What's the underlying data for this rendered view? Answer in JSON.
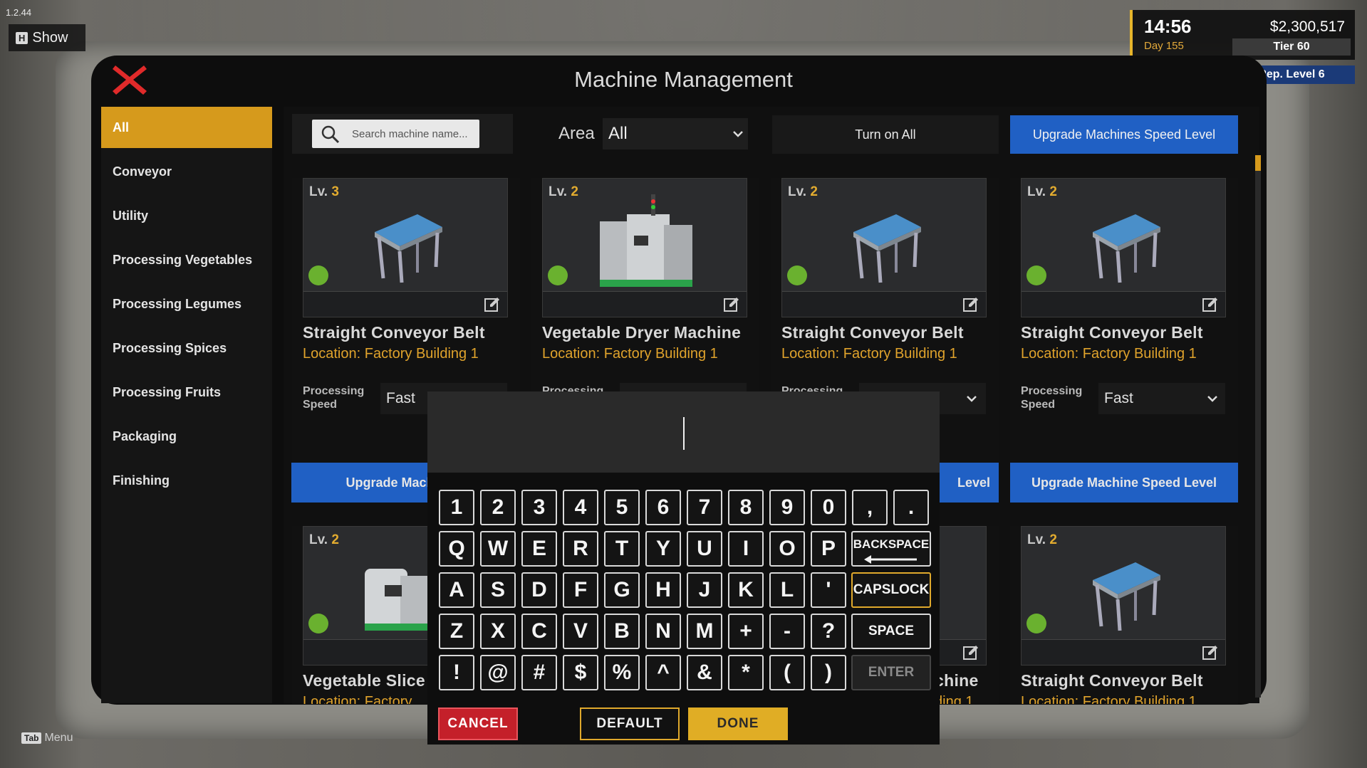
{
  "version": "1.2.44",
  "show_toggle": {
    "key": "H",
    "label": "Show"
  },
  "hud": {
    "time": "14:56",
    "day": "Day 155",
    "money": "$2,300,517",
    "tier": "Tier 60",
    "rep": "Rep. Level 6"
  },
  "title": "Machine Management",
  "sidebar": {
    "items": [
      {
        "label": "All",
        "active": true
      },
      {
        "label": "Conveyor"
      },
      {
        "label": "Utility"
      },
      {
        "label": "Processing Vegetables"
      },
      {
        "label": "Processing Legumes"
      },
      {
        "label": "Processing Spices"
      },
      {
        "label": "Processing Fruits"
      },
      {
        "label": "Packaging"
      },
      {
        "label": "Finishing"
      }
    ]
  },
  "toolbar": {
    "search_placeholder": "Search machine name...",
    "area_label": "Area",
    "area_value": "All",
    "turn_on_all": "Turn on All",
    "upgrade_all": "Upgrade Machines Speed Level"
  },
  "cards": [
    {
      "lv_prefix": "Lv. ",
      "lv": "3",
      "name": "Straight Conveyor Belt",
      "location": "Location: Factory Building 1",
      "speed_label": "Processing Speed",
      "speed": "Fast",
      "upgrade": "Upgrade Machine S"
    },
    {
      "lv_prefix": "Lv. ",
      "lv": "2",
      "name": "Vegetable Dryer Machine",
      "location": "Location: Factory Building 1",
      "speed_label": "Processing",
      "speed": "",
      "upgrade": ""
    },
    {
      "lv_prefix": "Lv. ",
      "lv": "2",
      "name": "Straight Conveyor Belt",
      "location": "Location: Factory Building 1",
      "speed_label": "Processing",
      "speed": "",
      "upgrade": "Level"
    },
    {
      "lv_prefix": "Lv. ",
      "lv": "2",
      "name": "Straight Conveyor Belt",
      "location": "Location: Factory Building 1",
      "speed_label": "Processing Speed",
      "speed": "Fast",
      "upgrade": "Upgrade Machine Speed Level"
    },
    {
      "lv_prefix": "Lv. ",
      "lv": "2",
      "name": "Vegetable Slice",
      "location": "Location: Factory",
      "status": "on"
    },
    {
      "name": "chine",
      "location": "ding 1"
    },
    {
      "lv_prefix": "Lv. ",
      "lv": "2",
      "name": "Straight Conveyor Belt",
      "location": "Location: Factory Building 1",
      "status": "on"
    }
  ],
  "keyboard": {
    "rows": [
      [
        "1",
        "2",
        "3",
        "4",
        "5",
        "6",
        "7",
        "8",
        "9",
        "0",
        ",",
        "."
      ],
      [
        "Q",
        "W",
        "E",
        "R",
        "T",
        "Y",
        "U",
        "I",
        "O",
        "P"
      ],
      [
        "A",
        "S",
        "D",
        "F",
        "G",
        "H",
        "J",
        "K",
        "L",
        "'"
      ],
      [
        "Z",
        "X",
        "C",
        "V",
        "B",
        "N",
        "M",
        "+",
        "-",
        "?"
      ],
      [
        "!",
        "@",
        "#",
        "$",
        "%",
        "^",
        "&",
        "*",
        "(",
        ")"
      ]
    ],
    "backspace": "BACKSPACE",
    "capslock": "CAPSLOCK",
    "space": "SPACE",
    "enter": "ENTER",
    "cancel": "CANCEL",
    "default": "DEFAULT",
    "done": "DONE"
  },
  "footer": {
    "key": "Tab",
    "label": "Menu"
  },
  "colors": {
    "accent": "#d69a1c",
    "blue": "#2060c4",
    "cancel": "#c4202a",
    "done": "#e0ad25",
    "status_on": "#6ab12f"
  }
}
